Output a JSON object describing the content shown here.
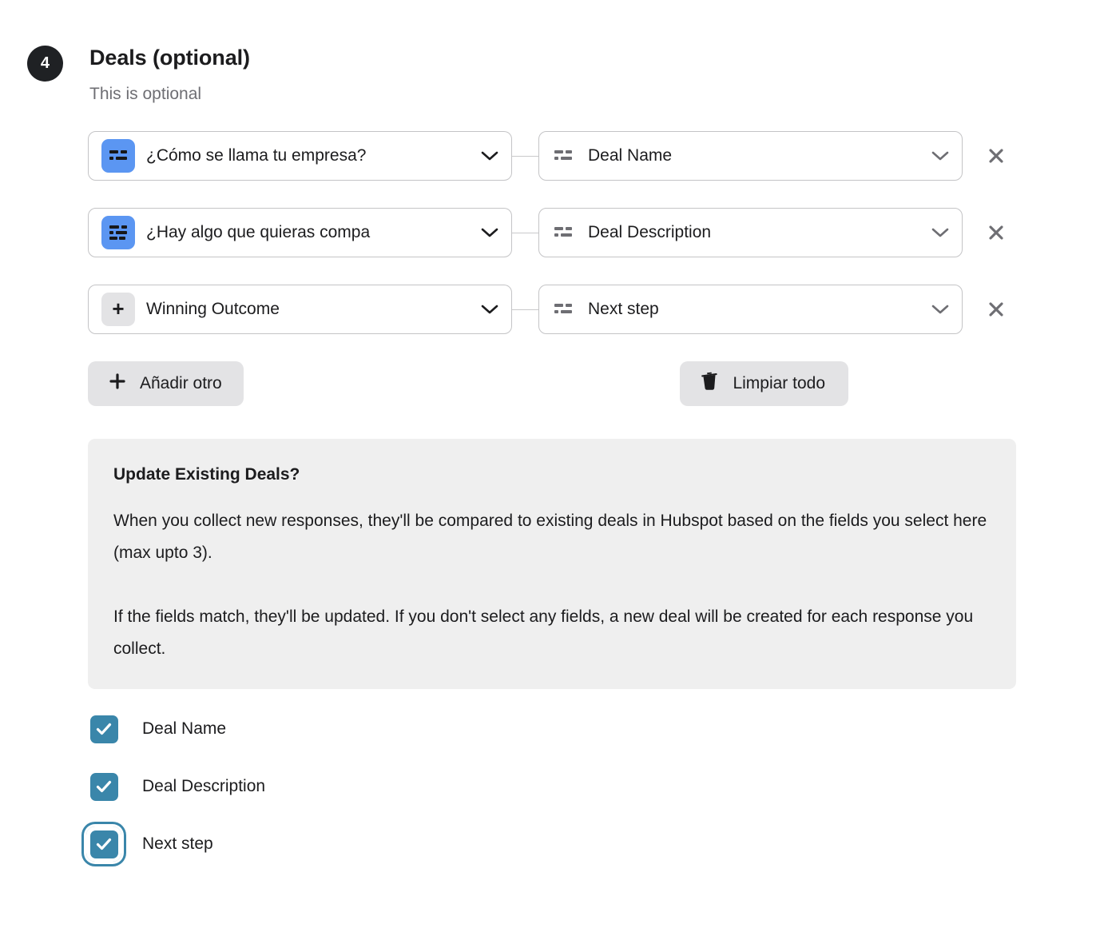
{
  "section": {
    "step_number": "4",
    "title": "Deals (optional)",
    "subtitle": "This is optional"
  },
  "colors": {
    "badge_bg": "#1f2124",
    "field_icon_blue": "#5b96f2",
    "checkbox_blue": "#3a86aa",
    "panel_bg": "#efefef",
    "button_bg": "#e3e3e5",
    "border": "#c4c4c6"
  },
  "mappings": [
    {
      "source": {
        "label": "¿Cómo se llama tu empresa?",
        "icon": "short-text-field-icon",
        "icon_style": "blue",
        "truncated": false
      },
      "target": {
        "label": "Deal Name",
        "icon": "short-text-field-icon",
        "icon_style": "gray"
      },
      "remove_icon": "close-icon"
    },
    {
      "source": {
        "label": "¿Hay algo que quieras compartir?",
        "label_visible": "¿Hay algo que quieras compa",
        "icon": "long-text-field-icon",
        "icon_style": "blue",
        "truncated": true
      },
      "target": {
        "label": "Deal Description",
        "icon": "short-text-field-icon",
        "icon_style": "gray"
      },
      "remove_icon": "close-icon"
    },
    {
      "source": {
        "label": "Winning Outcome",
        "icon": "plus-icon",
        "icon_style": "plus",
        "truncated": false
      },
      "target": {
        "label": "Next step",
        "icon": "short-text-field-icon",
        "icon_style": "gray"
      },
      "remove_icon": "close-icon"
    }
  ],
  "actions": {
    "add_another": {
      "label": "Añadir otro",
      "icon": "plus-icon"
    },
    "clear_all": {
      "label": "Limpiar todo",
      "icon": "trash-icon"
    }
  },
  "info_panel": {
    "title": "Update Existing Deals?",
    "paragraph_1": "When you collect new responses, they'll be compared to existing deals in Hubspot based on the fields you select here (max upto 3).",
    "paragraph_2": "If the fields match, they'll be updated. If you don't select any fields, a new deal will be created for each response you collect."
  },
  "match_fields": [
    {
      "label": "Deal Name",
      "checked": true,
      "focused": false
    },
    {
      "label": "Deal Description",
      "checked": true,
      "focused": false
    },
    {
      "label": "Next step",
      "checked": true,
      "focused": true
    }
  ]
}
